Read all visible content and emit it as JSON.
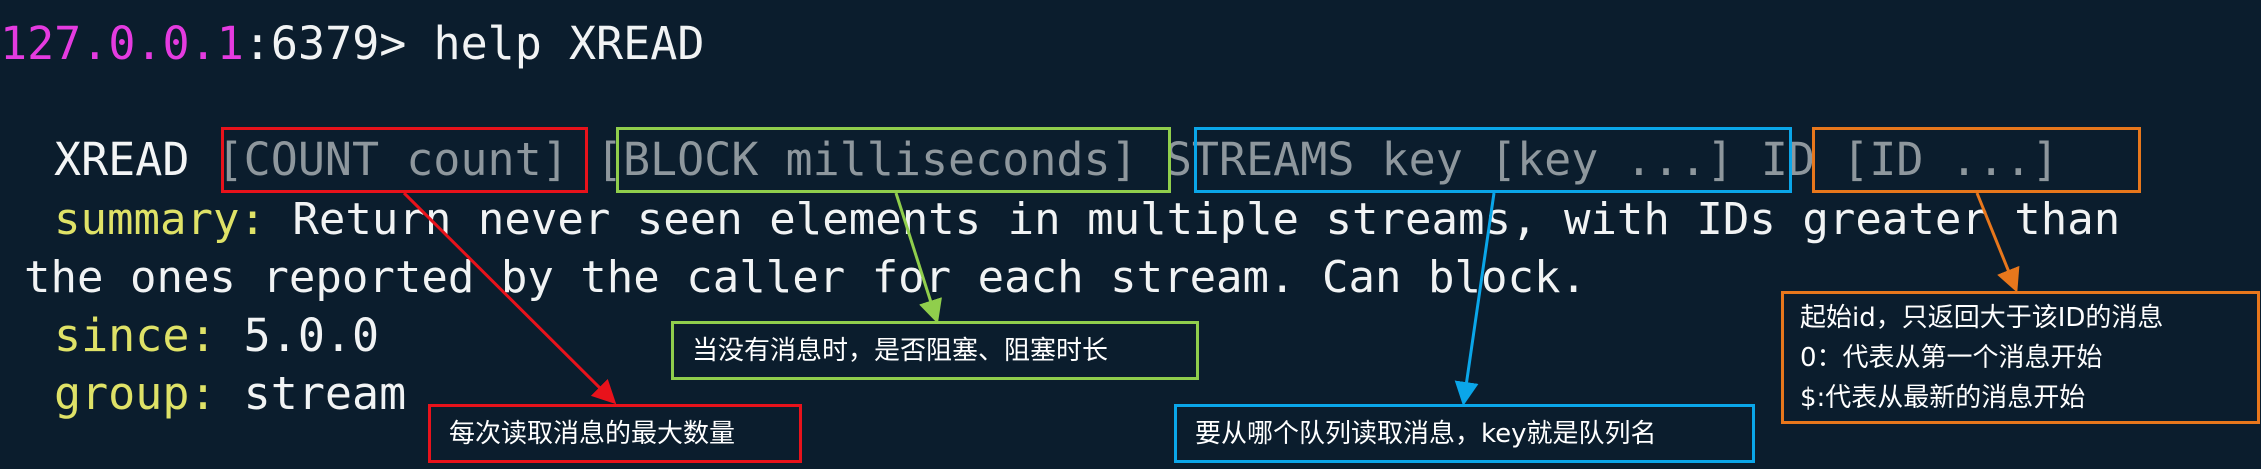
{
  "terminal": {
    "prompt_ip": "127.0.0.1",
    "prompt_port": ":6379>",
    "command": "help XREAD",
    "syntax": {
      "name": "XREAD",
      "arg_count": "[COUNT count]",
      "arg_block": "[BLOCK milliseconds]",
      "arg_streams": "STREAMS key [key ...]",
      "arg_id": "ID [ID ...]"
    },
    "summary_label": "summary:",
    "summary_text_1": "Return never seen elements in multiple streams, with IDs greater than",
    "summary_text_2": "the ones reported by the caller for each stream. Can block.",
    "since_label": "since:",
    "since_value": "5.0.0",
    "group_label": "group:",
    "group_value": "stream"
  },
  "annotations": {
    "count_note": "每次读取消息的最大数量",
    "block_note": "当没有消息时，是否阻塞、阻塞时长",
    "streams_note": "要从哪个队列读取消息，key就是队列名",
    "id_note_lines": [
      "起始id，只返回大于该ID的消息",
      "0：代表从第一个消息开始",
      "$:代表从最新的消息开始"
    ]
  },
  "colors": {
    "background": "#0b1d2d",
    "count": "#e8121b",
    "block": "#90ce4c",
    "streams": "#0aa6e9",
    "id": "#e8771c",
    "prompt_ip": "#e53be0",
    "keyword": "#dfe267"
  }
}
